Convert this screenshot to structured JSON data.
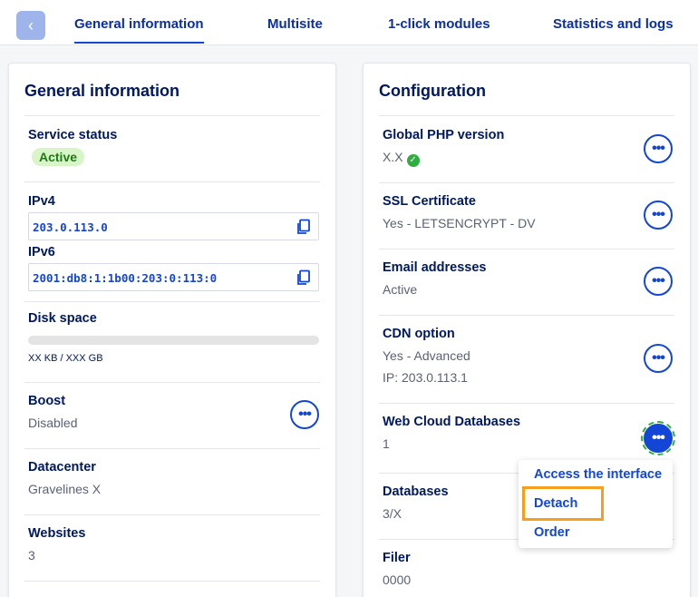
{
  "tabs": [
    {
      "label": "General information",
      "active": true
    },
    {
      "label": "Multisite"
    },
    {
      "label": "1-click modules"
    },
    {
      "label": "Statistics and logs"
    }
  ],
  "general": {
    "title": "General information",
    "service_status": {
      "label": "Service status",
      "value": "Active"
    },
    "ipv4": {
      "label": "IPv4",
      "value": "203.0.113.0"
    },
    "ipv6": {
      "label": "IPv6",
      "value": "2001:db8:1:1b00:203:0:113:0"
    },
    "disk": {
      "label": "Disk space",
      "value": "XX KB / XXX GB",
      "used_fraction": 0
    },
    "boost": {
      "label": "Boost",
      "value": "Disabled"
    },
    "datacenter": {
      "label": "Datacenter",
      "value": "Gravelines X"
    },
    "websites": {
      "label": "Websites",
      "value": "3"
    }
  },
  "config": {
    "title": "Configuration",
    "php": {
      "label": "Global PHP version",
      "value": "X.X"
    },
    "ssl": {
      "label": "SSL Certificate",
      "value": "Yes - LETSENCRYPT - DV"
    },
    "email": {
      "label": "Email addresses",
      "value": "Active"
    },
    "cdn": {
      "label": "CDN option",
      "value": "Yes - Advanced",
      "ip": "IP: 203.0.113.1"
    },
    "wcdb": {
      "label": "Web Cloud Databases",
      "value": "1"
    },
    "databases": {
      "label": "Databases",
      "value": "3/X"
    },
    "filer": {
      "label": "Filer",
      "value": "0000"
    }
  },
  "menu": {
    "items": [
      "Access the interface",
      "Detach",
      "Order"
    ],
    "highlighted": "Detach"
  },
  "colors": {
    "accent": "#1346d6",
    "highlight": "#f59f1c",
    "success": "#2dae3e"
  }
}
